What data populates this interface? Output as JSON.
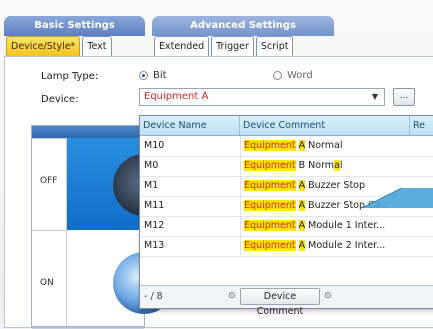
{
  "tabs": {
    "basic_group": "Basic Settings",
    "advanced_group": "Advanced Settings",
    "basic": [
      "Device/Style*",
      "Text"
    ],
    "advanced": [
      "Extended",
      "Trigger",
      "Script"
    ]
  },
  "form": {
    "lamp_type_label": "Lamp Type:",
    "options": [
      "Bit",
      "Word"
    ],
    "selected_option": "Bit",
    "device_label": "Device:",
    "device_value": "Equipment A",
    "browse_label": "..."
  },
  "states": {
    "off": "OFF",
    "on": "ON"
  },
  "dropdown": {
    "columns": [
      "Device Name",
      "Device Comment",
      "Re"
    ],
    "rows": [
      {
        "name": "M10",
        "comment_parts": [
          "Equipment",
          "A",
          "Normal"
        ]
      },
      {
        "name": "M0",
        "comment_parts": [
          "Equipment",
          "",
          "B Norm",
          "a",
          "l"
        ]
      },
      {
        "name": "M1",
        "comment_parts": [
          "Equipment",
          "A",
          "Buzzer Stop"
        ]
      },
      {
        "name": "M11",
        "comment_parts": [
          "Equipment",
          "A",
          "Buzzer Stop Ca..."
        ]
      },
      {
        "name": "M12",
        "comment_parts": [
          "Equipment",
          "A",
          "Module 1 Inter..."
        ]
      },
      {
        "name": "M13",
        "comment_parts": [
          "Equipment",
          "A",
          "Module 2 Inter..."
        ]
      }
    ],
    "footer": {
      "page": "- / 8",
      "info_icon": "info-icon",
      "button": "Device Comment"
    }
  },
  "colors": {
    "highlight": "#ffe600",
    "match_text": "#d4282a",
    "active_tab": "#f2c41c",
    "header_blue": "#5b7fc2"
  }
}
